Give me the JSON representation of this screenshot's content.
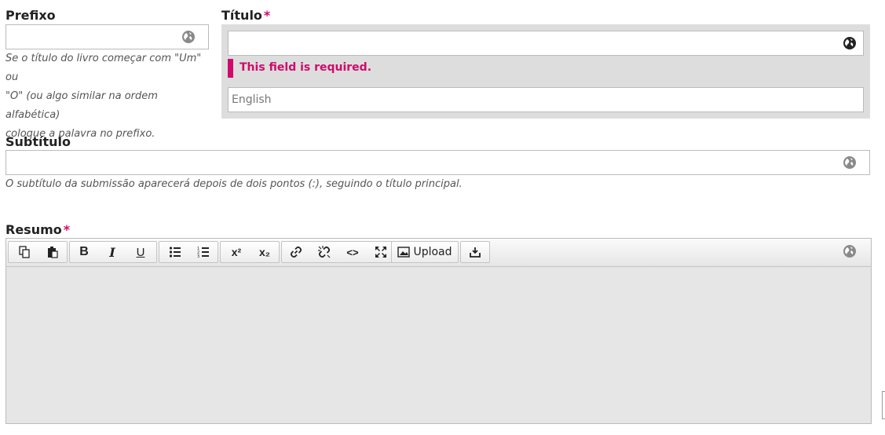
{
  "prefix": {
    "label": "Prefixo",
    "value": "",
    "help_lines": [
      "Se o título do livro começar com \"Um\" ou",
      "\"O\" (ou algo similar na ordem alfabética)",
      "coloque a palavra no prefixo."
    ]
  },
  "title": {
    "label": "Título",
    "required_mark": "*",
    "value": "",
    "error": "This field is required.",
    "lang_placeholder": "English"
  },
  "subtitle": {
    "label": "Subtítulo",
    "value": "",
    "help": "O subtítulo da submissão aparecerá depois de dois pontos (:), seguindo o título principal."
  },
  "abstract": {
    "label": "Resumo",
    "required_mark": "*",
    "toolbar": {
      "copy": "copy-icon",
      "paste": "paste-icon",
      "bold": "B",
      "italic": "I",
      "underline": "U",
      "bullet_list": "bullet-list-icon",
      "numbered_list": "numbered-list-icon",
      "superscript": "x²",
      "subscript": "x₂",
      "link": "link-icon",
      "unlink": "unlink-icon",
      "code": "<>",
      "fullscreen": "fullscreen-icon",
      "upload_label": "Upload",
      "insert": "insert-icon"
    }
  },
  "colors": {
    "required": "#d00a6c",
    "error_box": "#dddddd",
    "editor_bg": "#e6e6e6"
  }
}
